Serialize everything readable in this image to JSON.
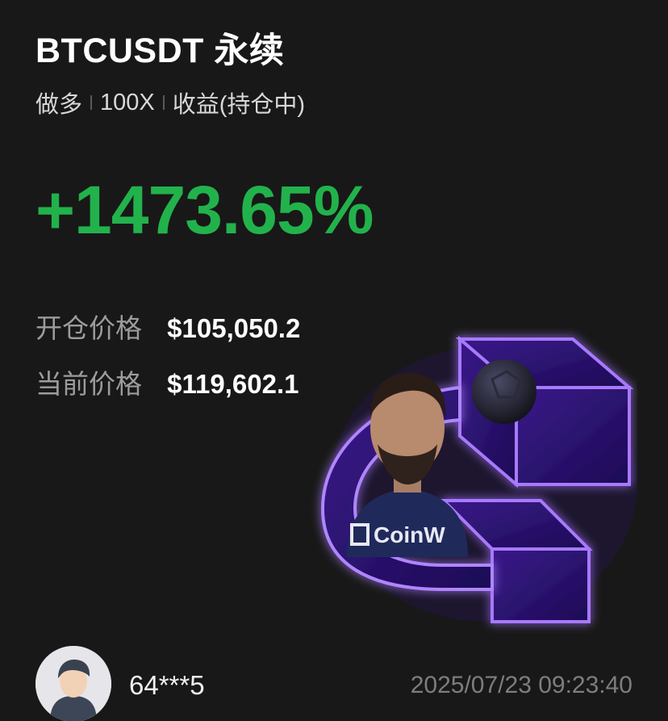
{
  "header": {
    "title": "BTCUSDT 永续",
    "direction": "做多",
    "leverage": "100X",
    "status": "收益(持仓中)"
  },
  "pnl": {
    "value": "+1473.65%",
    "color": "#22b24c"
  },
  "prices": {
    "open_label": "开仓价格",
    "open_value": "$105,050.2",
    "current_label": "当前价格",
    "current_value": "$119,602.1"
  },
  "promo": {
    "brand_text": "CoinW",
    "icon": "coinw-logo-icon",
    "accent_color": "#8a55ff"
  },
  "user": {
    "name": "64***5",
    "timestamp": "2025/07/23 09:23:40",
    "avatar_icon": "user-avatar-icon"
  }
}
